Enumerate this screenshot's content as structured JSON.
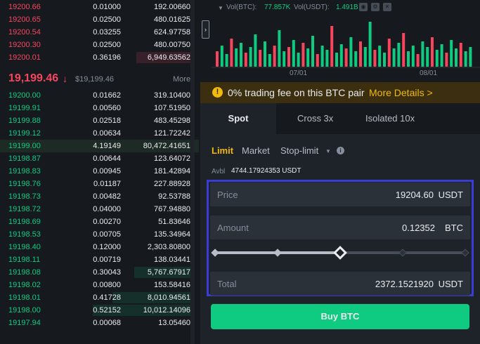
{
  "orderbook": {
    "asks": [
      {
        "price": "19200.66",
        "amount": "0.01000",
        "total": "192.00660",
        "depth": 0.0
      },
      {
        "price": "19200.65",
        "amount": "0.02500",
        "total": "480.01625",
        "depth": 0.0
      },
      {
        "price": "19200.54",
        "amount": "0.03255",
        "total": "624.97758",
        "depth": 0.0
      },
      {
        "price": "19200.30",
        "amount": "0.02500",
        "total": "480.00750",
        "depth": 0.0
      },
      {
        "price": "19200.01",
        "amount": "0.36196",
        "total": "6,949.63562",
        "depth": 0.3
      }
    ],
    "mid": {
      "price": "19,199.46",
      "arrow": "↓",
      "usd": "$19,199.46",
      "more": "More"
    },
    "bids": [
      {
        "price": "19200.00",
        "amount": "0.01662",
        "total": "319.10400",
        "depth": 0.0
      },
      {
        "price": "19199.91",
        "amount": "0.00560",
        "total": "107.51950",
        "depth": 0.0
      },
      {
        "price": "19199.88",
        "amount": "0.02518",
        "total": "483.45298",
        "depth": 0.0
      },
      {
        "price": "19199.12",
        "amount": "0.00634",
        "total": "121.72242",
        "depth": 0.0
      },
      {
        "price": "19199.00",
        "amount": "4.19149",
        "total": "80,472.41651",
        "depth": 0.0,
        "highlight": true
      },
      {
        "price": "19198.87",
        "amount": "0.00644",
        "total": "123.64072",
        "depth": 0.0
      },
      {
        "price": "19198.83",
        "amount": "0.00945",
        "total": "181.42894",
        "depth": 0.0
      },
      {
        "price": "19198.76",
        "amount": "0.01187",
        "total": "227.88928",
        "depth": 0.0
      },
      {
        "price": "19198.73",
        "amount": "0.00482",
        "total": "92.53788",
        "depth": 0.0
      },
      {
        "price": "19198.72",
        "amount": "0.04000",
        "total": "767.94880",
        "depth": 0.0
      },
      {
        "price": "19198.69",
        "amount": "0.00270",
        "total": "51.83646",
        "depth": 0.0
      },
      {
        "price": "19198.53",
        "amount": "0.00705",
        "total": "135.34964",
        "depth": 0.0
      },
      {
        "price": "19198.40",
        "amount": "0.12000",
        "total": "2,303.80800",
        "depth": 0.0
      },
      {
        "price": "19198.11",
        "amount": "0.00719",
        "total": "138.03441",
        "depth": 0.0
      },
      {
        "price": "19198.08",
        "amount": "0.30043",
        "total": "5,767.67917",
        "depth": 0.31
      },
      {
        "price": "19198.02",
        "amount": "0.00800",
        "total": "153.58416",
        "depth": 0.0
      },
      {
        "price": "19198.01",
        "amount": "0.41728",
        "total": "8,010.94561",
        "depth": 0.43
      },
      {
        "price": "19198.00",
        "amount": "0.52152",
        "total": "10,012.14096",
        "depth": 0.54
      },
      {
        "price": "19197.94",
        "amount": "0.00068",
        "total": "13.05460",
        "depth": 0.0
      }
    ]
  },
  "chart": {
    "caret": "▼",
    "vol_btc_label": "Vol(BTC):",
    "vol_btc_value": "77.857K",
    "vol_usdt_label": "Vol(USDT):",
    "vol_usdt_value": "1.491B",
    "collapse_glyph": "›",
    "dates": [
      "07/01",
      "08/01"
    ],
    "up_color": "#0ecb81",
    "down_color": "#f6465d"
  },
  "banner": {
    "icon": "!",
    "text": "0% trading fee on this BTC pair",
    "link": "More Details >"
  },
  "tabs": {
    "spot": "Spot",
    "cross": "Cross 3x",
    "isolated": "Isolated 10x"
  },
  "order_types": {
    "limit": "Limit",
    "market": "Market",
    "stop_limit": "Stop-limit",
    "caret": "▼",
    "info": "i"
  },
  "avbl": {
    "label": "Avbl",
    "value": "4744.17924353 USDT"
  },
  "form": {
    "price_label": "Price",
    "price_value": "19204.60",
    "price_unit": "USDT",
    "amount_label": "Amount",
    "amount_value": "0.12352",
    "amount_unit": "BTC",
    "total_label": "Total",
    "total_value": "2372.1521920",
    "total_unit": "USDT",
    "slider_percent": 50
  },
  "buy_button": "Buy BTC",
  "colors": {
    "accent": "#f0b90b",
    "buy": "#0ecb81",
    "sell": "#f6465d",
    "highlight_frame": "#3b3bd6"
  }
}
